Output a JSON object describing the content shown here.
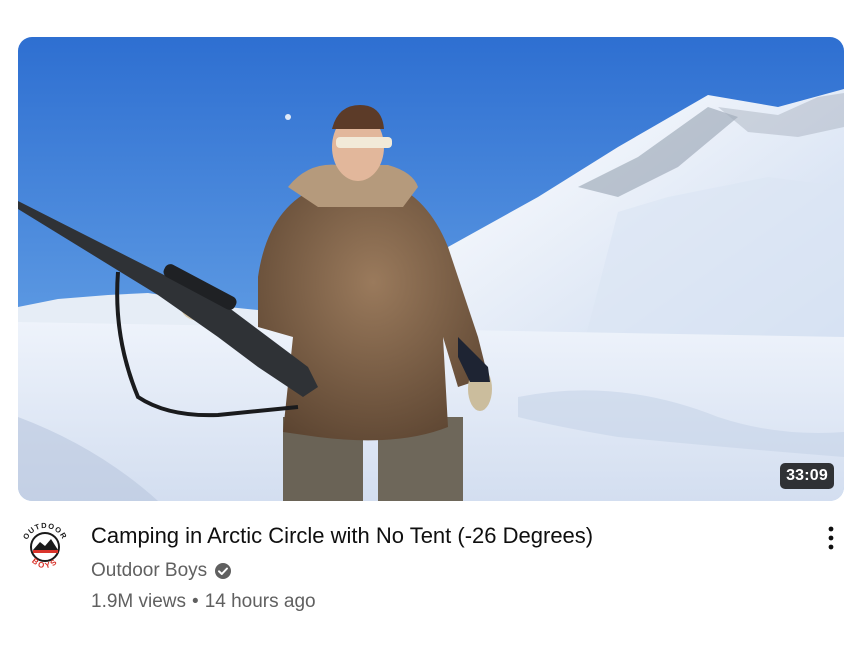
{
  "video": {
    "duration": "33:09",
    "title": "Camping in Arctic Circle with No Tent (-26 Degrees)",
    "channel": {
      "name": "Outdoor Boys",
      "verified": true,
      "avatar_text_top": "OUTDOOR",
      "avatar_text_bottom": "BOYS"
    },
    "views": "1.9M views",
    "separator": "•",
    "age": "14 hours ago"
  },
  "icons": {
    "menu": "more-vert-icon",
    "verified": "verified-check-icon"
  },
  "colors": {
    "title": "#0f0f0f",
    "secondary_text": "#606060",
    "duration_bg": "#000000",
    "avatar_accent": "#d9342b"
  }
}
